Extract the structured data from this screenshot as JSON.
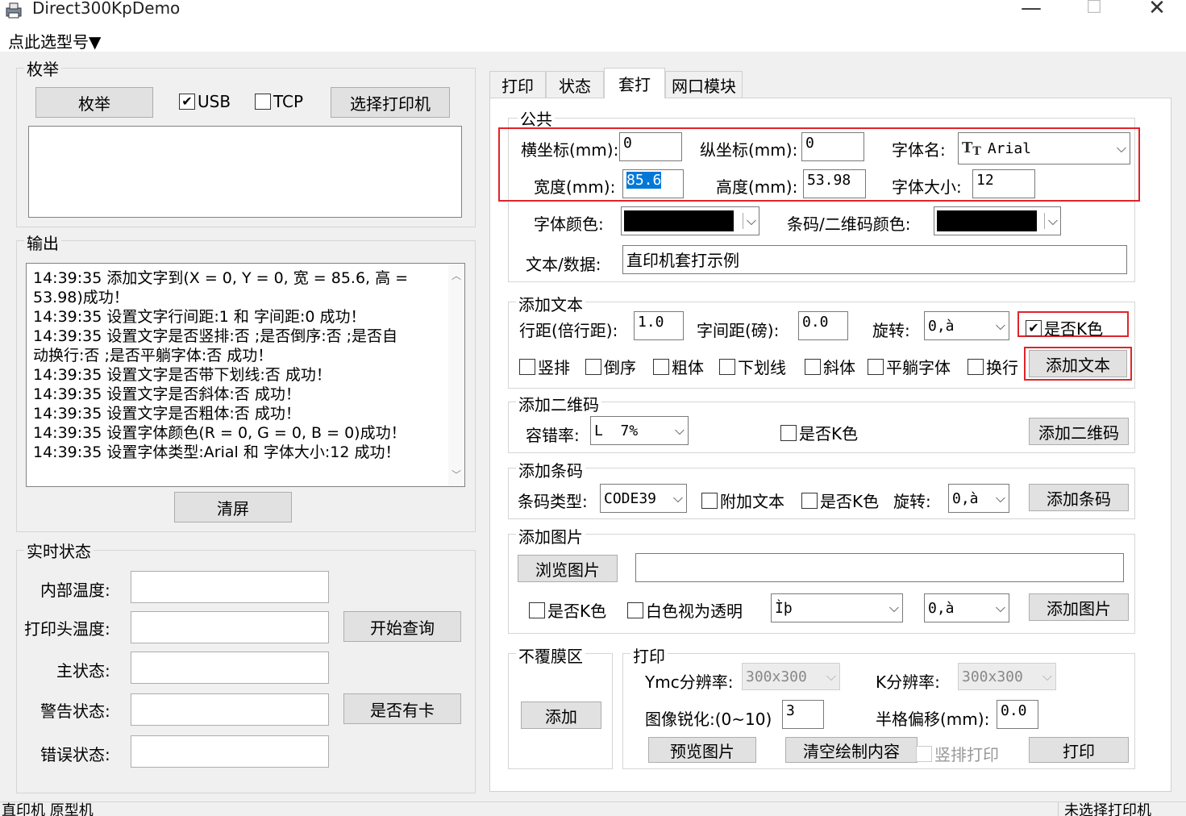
{
  "window": {
    "title": "Direct300KpDemo",
    "minimize": "—",
    "maximize": "☐",
    "close": "✕"
  },
  "menu": {
    "model_select": "点此选型号▼"
  },
  "enumerate": {
    "legend": "枚举",
    "enum_button": "枚举",
    "usb_label": "USB",
    "usb_checked": true,
    "tcp_label": "TCP",
    "tcp_checked": false,
    "select_printer_button": "选择打印机"
  },
  "output": {
    "legend": "输出",
    "lines": [
      "14:39:35 添加文字到(X = 0, Y = 0, 宽 = 85.6, 高 =",
      "53.98)成功！",
      "14:39:35 设置文字行间距:1 和 字间距:0 成功！",
      "14:39:35 设置文字是否竖排:否 ;是否倒序:否 ;是否自",
      "动换行:否 ;是否平躺字体:否  成功！",
      "14:39:35 设置文字是否带下划线:否 成功！",
      "14:39:35 设置文字是否斜体:否 成功！",
      "14:39:35 设置文字是否粗体:否 成功！",
      "14:39:35 设置字体颜色(R = 0, G = 0, B = 0)成功！",
      "14:39:35 设置字体类型:Arial 和 字体大小:12 成功！"
    ],
    "clear_button": "清屏"
  },
  "realtime": {
    "legend": "实时状态",
    "internal_temp_label": "内部温度:",
    "head_temp_label": "打印头温度:",
    "main_status_label": "主状态:",
    "warning_status_label": "警告状态:",
    "error_status_label": "错误状态:",
    "start_query_button": "开始查询",
    "has_card_button": "是否有卡"
  },
  "tabs": [
    "打印",
    "状态",
    "套打",
    "网口模块"
  ],
  "active_tab": "套打",
  "common": {
    "legend": "公共",
    "x_label": "横坐标(mm):",
    "x_value": "0",
    "y_label": "纵坐标(mm):",
    "y_value": "0",
    "font_name_label": "字体名:",
    "font_name_value": "Arial",
    "font_icon": "truetype-icon",
    "width_label": "宽度(mm):",
    "width_value": "85.6",
    "height_label": "高度(mm):",
    "height_value": "53.98",
    "font_size_label": "字体大小:",
    "font_size_value": "12",
    "font_color_label": "字体颜色:",
    "font_color": "#000000",
    "barcode_color_label": "条码/二维码颜色:",
    "barcode_color": "#000000",
    "text_data_label": "文本/数据:",
    "text_data_value": "直印机套打示例"
  },
  "add_text": {
    "legend": "添加文本",
    "line_spacing_label": "行距(倍行距):",
    "line_spacing_value": "1.0",
    "char_spacing_label": "字间距(磅):",
    "char_spacing_value": "0.0",
    "rotate_label": "旋转:",
    "rotate_value": "0,à",
    "is_k_label": "是否K色",
    "is_k_checked": true,
    "vertical_label": "竖排",
    "reverse_label": "倒序",
    "bold_label": "粗体",
    "underline_label": "下划线",
    "italic_label": "斜体",
    "flat_label": "平躺字体",
    "wrap_label": "换行",
    "add_button": "添加文本"
  },
  "add_qr": {
    "legend": "添加二维码",
    "error_rate_label": "容错率:",
    "error_rate_value": "L  7%",
    "is_k_label": "是否K色",
    "add_button": "添加二维码"
  },
  "add_barcode": {
    "legend": "添加条码",
    "type_label": "条码类型:",
    "type_value": "CODE39",
    "append_text_label": "附加文本",
    "is_k_label": "是否K色",
    "rotate_label": "旋转:",
    "rotate_value": "0,à",
    "add_button": "添加条码"
  },
  "add_image": {
    "legend": "添加图片",
    "browse_button": "浏览图片",
    "path_value": "",
    "is_k_label": "是否K色",
    "white_transparent_label": "白色视为透明",
    "mode_value": "Ìþ",
    "rotate_value": "0,à",
    "add_button": "添加图片"
  },
  "no_overlay": {
    "legend": "不覆膜区",
    "add_button": "添加"
  },
  "print": {
    "legend": "打印",
    "ymc_res_label": "Ymc分辨率:",
    "ymc_res_value": "300x300",
    "k_res_label": "K分辨率:",
    "k_res_value": "300x300",
    "sharpen_label": "图像锐化:(0~10)",
    "sharpen_value": "3",
    "half_offset_label": "半格偏移(mm):",
    "half_offset_value": "0.0",
    "preview_button": "预览图片",
    "clear_button": "清空绘制内容",
    "vertical_print_label": "竖排打印",
    "print_button": "打印"
  },
  "status": {
    "left": "直印机 原型机",
    "right": "未选择打印机"
  }
}
